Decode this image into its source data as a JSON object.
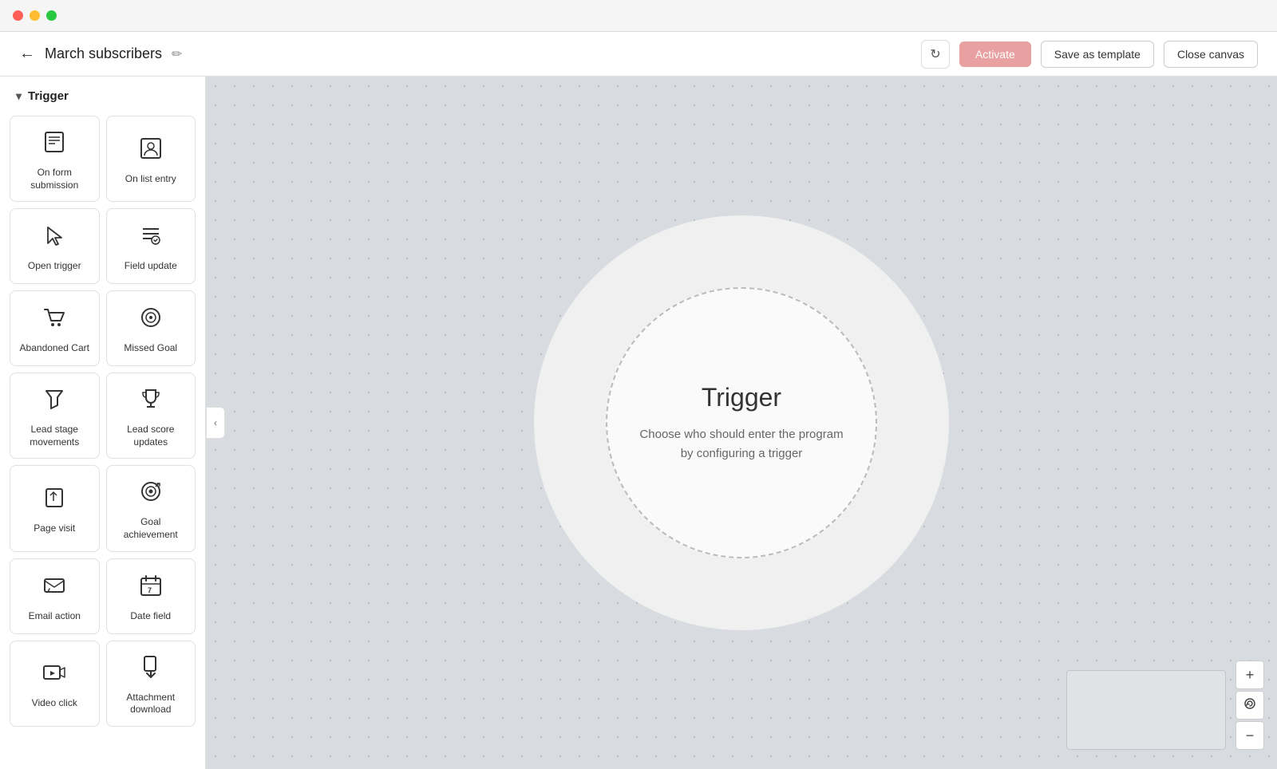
{
  "window": {
    "dots": [
      "red",
      "yellow",
      "green"
    ]
  },
  "header": {
    "back_icon": "←",
    "title": "March subscribers",
    "edit_icon": "✏",
    "refresh_icon": "↻",
    "activate_label": "Activate",
    "save_template_label": "Save as template",
    "close_canvas_label": "Close canvas"
  },
  "sidebar": {
    "section_label": "Trigger",
    "chevron": "▾",
    "items": [
      {
        "id": "on-form-submission",
        "label": "On form submission",
        "icon": "form"
      },
      {
        "id": "on-list-entry",
        "label": "On list entry",
        "icon": "person"
      },
      {
        "id": "open-trigger",
        "label": "Open trigger",
        "icon": "cursor"
      },
      {
        "id": "field-update",
        "label": "Field update",
        "icon": "field"
      },
      {
        "id": "abandoned-cart",
        "label": "Abandoned Cart",
        "icon": "cart"
      },
      {
        "id": "missed-goal",
        "label": "Missed Goal",
        "icon": "goal"
      },
      {
        "id": "lead-stage-movements",
        "label": "Lead stage movements",
        "icon": "funnel"
      },
      {
        "id": "lead-score-updates",
        "label": "Lead score updates",
        "icon": "trophy"
      },
      {
        "id": "page-visit",
        "label": "Page visit",
        "icon": "page"
      },
      {
        "id": "goal-achievement",
        "label": "Goal achievement",
        "icon": "target"
      },
      {
        "id": "email-action",
        "label": "Email action",
        "icon": "email"
      },
      {
        "id": "date-field",
        "label": "Date field",
        "icon": "calendar"
      },
      {
        "id": "video-click",
        "label": "Video click",
        "icon": "video"
      },
      {
        "id": "attachment-download",
        "label": "Attachment download",
        "icon": "attachment"
      }
    ]
  },
  "canvas": {
    "trigger_title": "Trigger",
    "trigger_desc": "Choose who should enter the program by configuring a trigger"
  },
  "minimap": {},
  "zoom": {
    "zoom_in": "+",
    "reset": "⟳",
    "zoom_out": "−"
  }
}
